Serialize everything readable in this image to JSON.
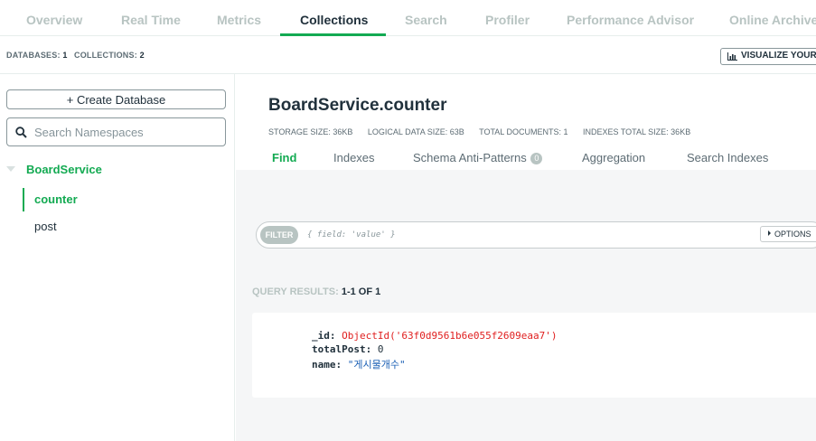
{
  "topnav": {
    "tabs": [
      "Overview",
      "Real Time",
      "Metrics",
      "Collections",
      "Search",
      "Profiler",
      "Performance Advisor",
      "Online Archive"
    ],
    "active_index": 3
  },
  "statsbar": {
    "databases_label": "DATABASES:",
    "databases_count": "1",
    "collections_label": "COLLECTIONS:",
    "collections_count": "2",
    "visualize_label": "VISUALIZE YOUR DATA"
  },
  "sidebar": {
    "create_database_label": "+ Create Database",
    "search_placeholder": "Search Namespaces",
    "database": {
      "name": "BoardService",
      "collections": [
        "counter",
        "post"
      ],
      "active_collection_index": 0
    }
  },
  "collection": {
    "title": "BoardService.counter",
    "stats": {
      "storage_size": "STORAGE SIZE: 36KB",
      "logical_size": "LOGICAL DATA SIZE: 63B",
      "total_documents": "TOTAL DOCUMENTS: 1",
      "indexes_size": "INDEXES TOTAL SIZE: 36KB"
    },
    "tabs": {
      "find": "Find",
      "indexes": "Indexes",
      "schema": "Schema Anti-Patterns",
      "schema_badge": "0",
      "aggregation": "Aggregation",
      "search_indexes": "Search Indexes"
    }
  },
  "query": {
    "filter_label": "FILTER",
    "filter_placeholder": "{ field: 'value' }",
    "options_label": "OPTIONS",
    "results_label": "QUERY RESULTS:",
    "results_range": "1-1 OF 1"
  },
  "document": {
    "fields": [
      {
        "key": "_id",
        "value": "ObjectId('63f0d9561b6e055f2609eaa7')",
        "type": "oid"
      },
      {
        "key": "totalPost",
        "value": "0",
        "type": "num"
      },
      {
        "key": "name",
        "value": "\"게시물개수\"",
        "type": "str"
      }
    ]
  },
  "colors": {
    "accent": "#13aa52",
    "text": "#21313c",
    "muted": "#b8c4c2",
    "objectid": "#e02020",
    "string": "#1a5fb4"
  }
}
